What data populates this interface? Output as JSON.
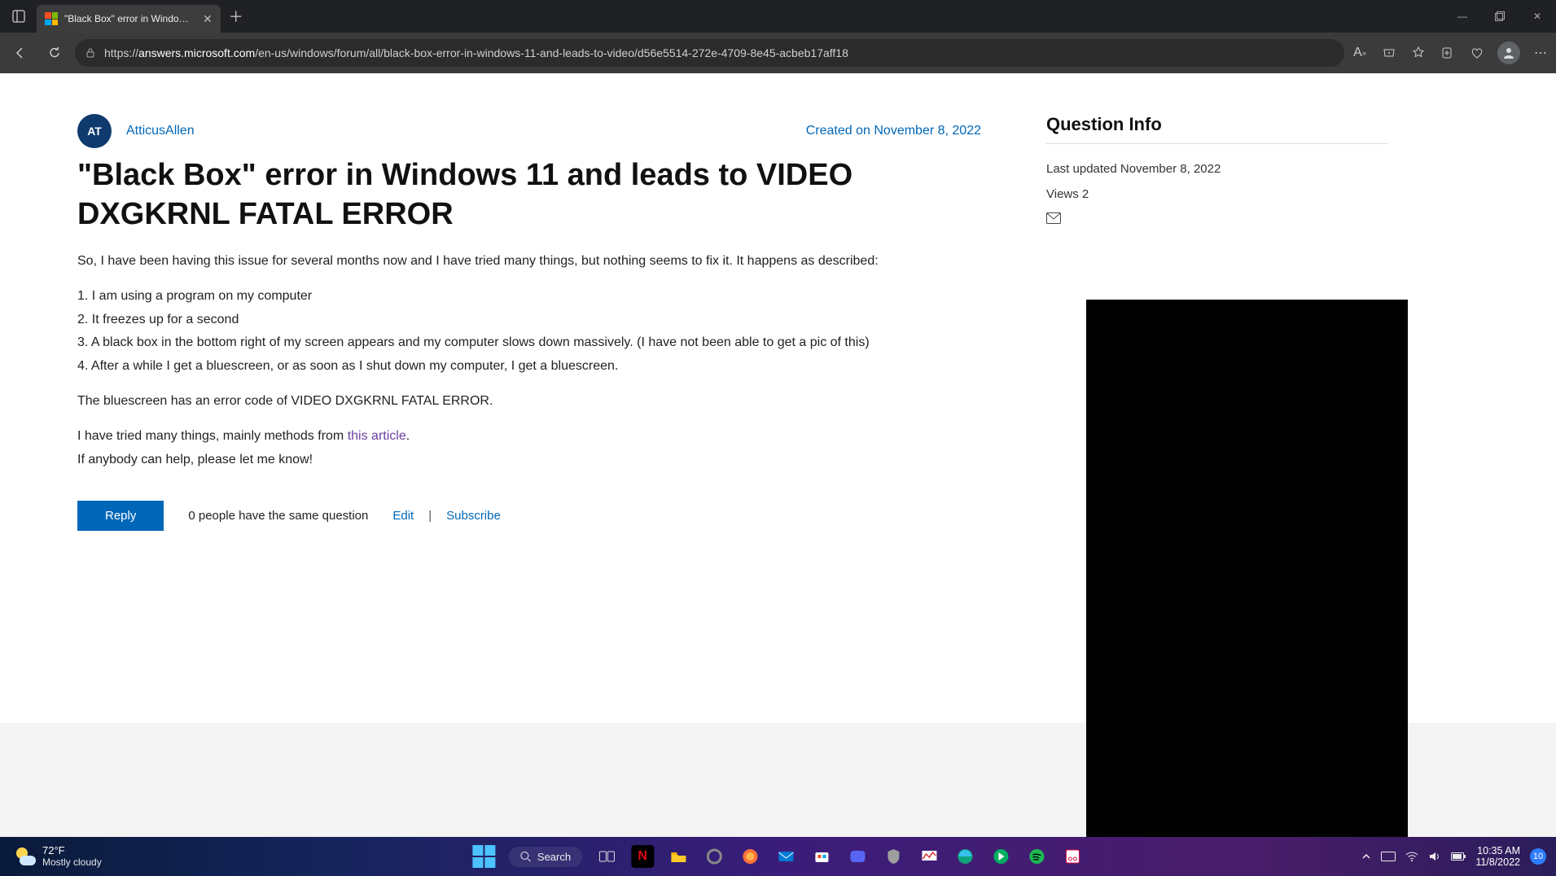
{
  "browser": {
    "tab_title": "\"Black Box\" error in Windows 11",
    "url_display_prefix": "https://",
    "url_domain": "answers.microsoft.com",
    "url_path": "/en-us/windows/forum/all/black-box-error-in-windows-11-and-leads-to-video/d56e5514-272e-4709-8e45-acbeb17aff18"
  },
  "post": {
    "avatar_initials": "AT",
    "author": "AtticusAllen",
    "created": "Created on November 8, 2022",
    "title": "\"Black Box\" error in Windows 11 and leads to VIDEO DXGKRNL FATAL ERROR",
    "body": {
      "intro": "So, I have been having this issue for several months now and I have tried many things, but nothing seems to fix it. It happens as described:",
      "step1": "1. I am using a program on my computer",
      "step2": "2. It freezes up for a second",
      "step3": "3. A black box in the bottom right of my screen appears and my computer slows down massively. (I have not been able to get a pic of this)",
      "step4": "4. After a while I get a bluescreen, or as soon as I shut down my computer, I get a bluescreen.",
      "bsod": "The bluescreen has an error code of VIDEO DXGKRNL FATAL ERROR.",
      "tried_prefix": "I have tried many things, mainly methods from ",
      "tried_link": "this article",
      "tried_suffix": ".",
      "help": "If anybody can help, please let me know!"
    },
    "actions": {
      "reply": "Reply",
      "same_question": "0 people have the same question",
      "edit": "Edit",
      "subscribe": "Subscribe"
    }
  },
  "sidebar": {
    "title": "Question Info",
    "last_updated": "Last updated November 8, 2022",
    "views": "Views 2"
  },
  "taskbar": {
    "weather_temp": "72°F",
    "weather_cond": "Mostly cloudy",
    "search_label": "Search",
    "time": "10:35 AM",
    "date": "11/8/2022",
    "notif_count": "10"
  }
}
